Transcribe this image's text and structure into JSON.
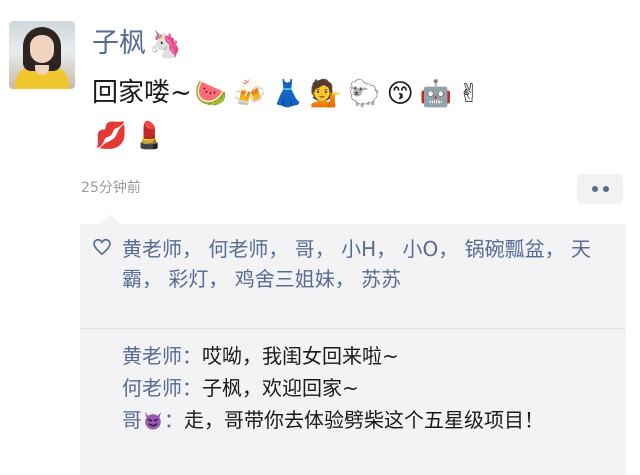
{
  "post": {
    "username": "子枫",
    "username_emoji": "🦄",
    "text": "回家喽~",
    "emojis_line1": [
      "🍉",
      "🍻",
      "👗",
      "💁",
      "🐑",
      "😙",
      "🤖",
      "✌"
    ],
    "emojis_line2": [
      "💋",
      "💄"
    ],
    "timestamp": "25分钟前"
  },
  "likes": {
    "names": [
      "黄老师，",
      "何老师，",
      "哥，",
      "小H，",
      "小O，",
      "锅碗瓢盆，",
      "天霸，",
      "彩灯，",
      "鸡舍三姐妹，",
      "苏苏"
    ]
  },
  "comments": [
    {
      "author": "黄老师",
      "separator": "：",
      "text": "哎呦，我闺女回来啦~"
    },
    {
      "author": "何老师",
      "separator": "：",
      "text": "子枫，欢迎回家~"
    },
    {
      "author": "哥",
      "separator": "：",
      "text": "走，哥带你去体验劈柴这个五星级项目！"
    }
  ],
  "colors": {
    "link": "#576b95",
    "text": "#1a1a1a",
    "muted": "#9b9b9b",
    "panel": "#f3f3f5"
  }
}
